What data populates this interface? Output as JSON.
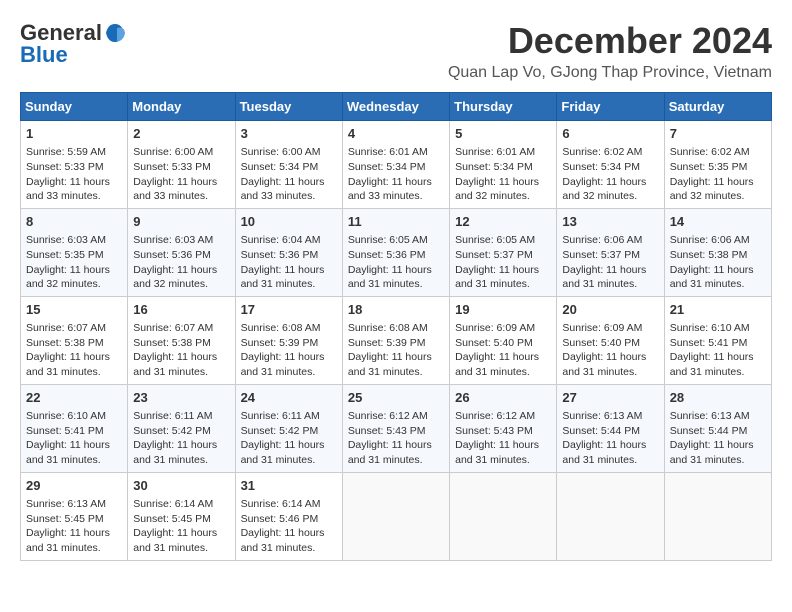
{
  "logo": {
    "general": "General",
    "blue": "Blue"
  },
  "header": {
    "title": "December 2024",
    "subtitle": "Quan Lap Vo, GJong Thap Province, Vietnam"
  },
  "weekdays": [
    "Sunday",
    "Monday",
    "Tuesday",
    "Wednesday",
    "Thursday",
    "Friday",
    "Saturday"
  ],
  "weeks": [
    [
      {
        "day": "1",
        "info": "Sunrise: 5:59 AM\nSunset: 5:33 PM\nDaylight: 11 hours\nand 33 minutes."
      },
      {
        "day": "2",
        "info": "Sunrise: 6:00 AM\nSunset: 5:33 PM\nDaylight: 11 hours\nand 33 minutes."
      },
      {
        "day": "3",
        "info": "Sunrise: 6:00 AM\nSunset: 5:34 PM\nDaylight: 11 hours\nand 33 minutes."
      },
      {
        "day": "4",
        "info": "Sunrise: 6:01 AM\nSunset: 5:34 PM\nDaylight: 11 hours\nand 33 minutes."
      },
      {
        "day": "5",
        "info": "Sunrise: 6:01 AM\nSunset: 5:34 PM\nDaylight: 11 hours\nand 32 minutes."
      },
      {
        "day": "6",
        "info": "Sunrise: 6:02 AM\nSunset: 5:34 PM\nDaylight: 11 hours\nand 32 minutes."
      },
      {
        "day": "7",
        "info": "Sunrise: 6:02 AM\nSunset: 5:35 PM\nDaylight: 11 hours\nand 32 minutes."
      }
    ],
    [
      {
        "day": "8",
        "info": "Sunrise: 6:03 AM\nSunset: 5:35 PM\nDaylight: 11 hours\nand 32 minutes."
      },
      {
        "day": "9",
        "info": "Sunrise: 6:03 AM\nSunset: 5:36 PM\nDaylight: 11 hours\nand 32 minutes."
      },
      {
        "day": "10",
        "info": "Sunrise: 6:04 AM\nSunset: 5:36 PM\nDaylight: 11 hours\nand 31 minutes."
      },
      {
        "day": "11",
        "info": "Sunrise: 6:05 AM\nSunset: 5:36 PM\nDaylight: 11 hours\nand 31 minutes."
      },
      {
        "day": "12",
        "info": "Sunrise: 6:05 AM\nSunset: 5:37 PM\nDaylight: 11 hours\nand 31 minutes."
      },
      {
        "day": "13",
        "info": "Sunrise: 6:06 AM\nSunset: 5:37 PM\nDaylight: 11 hours\nand 31 minutes."
      },
      {
        "day": "14",
        "info": "Sunrise: 6:06 AM\nSunset: 5:38 PM\nDaylight: 11 hours\nand 31 minutes."
      }
    ],
    [
      {
        "day": "15",
        "info": "Sunrise: 6:07 AM\nSunset: 5:38 PM\nDaylight: 11 hours\nand 31 minutes."
      },
      {
        "day": "16",
        "info": "Sunrise: 6:07 AM\nSunset: 5:38 PM\nDaylight: 11 hours\nand 31 minutes."
      },
      {
        "day": "17",
        "info": "Sunrise: 6:08 AM\nSunset: 5:39 PM\nDaylight: 11 hours\nand 31 minutes."
      },
      {
        "day": "18",
        "info": "Sunrise: 6:08 AM\nSunset: 5:39 PM\nDaylight: 11 hours\nand 31 minutes."
      },
      {
        "day": "19",
        "info": "Sunrise: 6:09 AM\nSunset: 5:40 PM\nDaylight: 11 hours\nand 31 minutes."
      },
      {
        "day": "20",
        "info": "Sunrise: 6:09 AM\nSunset: 5:40 PM\nDaylight: 11 hours\nand 31 minutes."
      },
      {
        "day": "21",
        "info": "Sunrise: 6:10 AM\nSunset: 5:41 PM\nDaylight: 11 hours\nand 31 minutes."
      }
    ],
    [
      {
        "day": "22",
        "info": "Sunrise: 6:10 AM\nSunset: 5:41 PM\nDaylight: 11 hours\nand 31 minutes."
      },
      {
        "day": "23",
        "info": "Sunrise: 6:11 AM\nSunset: 5:42 PM\nDaylight: 11 hours\nand 31 minutes."
      },
      {
        "day": "24",
        "info": "Sunrise: 6:11 AM\nSunset: 5:42 PM\nDaylight: 11 hours\nand 31 minutes."
      },
      {
        "day": "25",
        "info": "Sunrise: 6:12 AM\nSunset: 5:43 PM\nDaylight: 11 hours\nand 31 minutes."
      },
      {
        "day": "26",
        "info": "Sunrise: 6:12 AM\nSunset: 5:43 PM\nDaylight: 11 hours\nand 31 minutes."
      },
      {
        "day": "27",
        "info": "Sunrise: 6:13 AM\nSunset: 5:44 PM\nDaylight: 11 hours\nand 31 minutes."
      },
      {
        "day": "28",
        "info": "Sunrise: 6:13 AM\nSunset: 5:44 PM\nDaylight: 11 hours\nand 31 minutes."
      }
    ],
    [
      {
        "day": "29",
        "info": "Sunrise: 6:13 AM\nSunset: 5:45 PM\nDaylight: 11 hours\nand 31 minutes."
      },
      {
        "day": "30",
        "info": "Sunrise: 6:14 AM\nSunset: 5:45 PM\nDaylight: 11 hours\nand 31 minutes."
      },
      {
        "day": "31",
        "info": "Sunrise: 6:14 AM\nSunset: 5:46 PM\nDaylight: 11 hours\nand 31 minutes."
      },
      {
        "day": "",
        "info": ""
      },
      {
        "day": "",
        "info": ""
      },
      {
        "day": "",
        "info": ""
      },
      {
        "day": "",
        "info": ""
      }
    ]
  ]
}
